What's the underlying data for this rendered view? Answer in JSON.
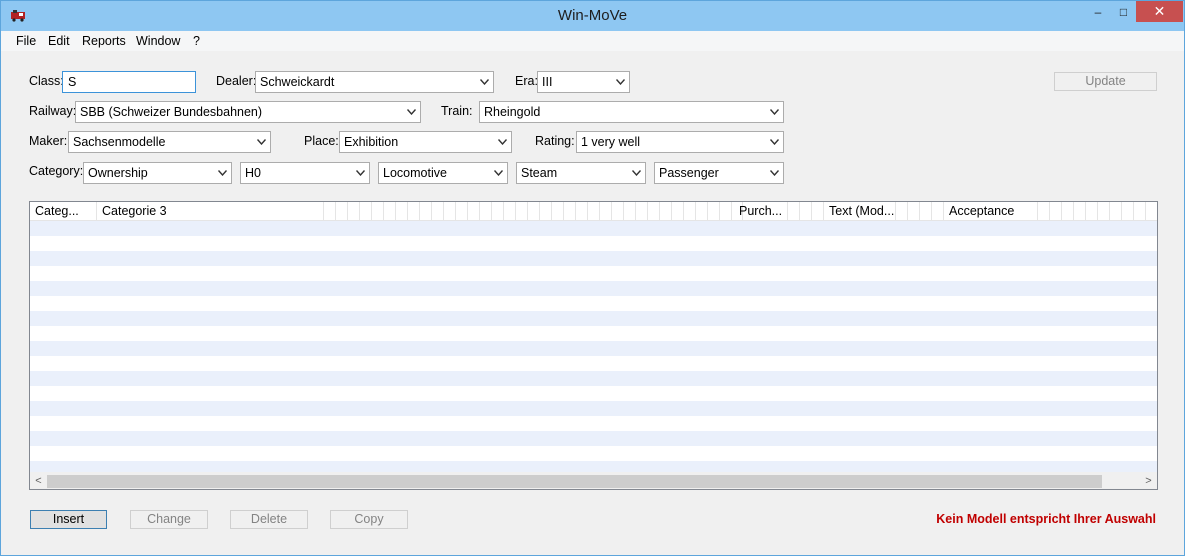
{
  "window": {
    "title": "Win-MoVe",
    "minimize": "–",
    "maximize": "□",
    "close": "✕"
  },
  "menu": {
    "items": [
      "File",
      "Edit",
      "Reports",
      "Window",
      "?"
    ]
  },
  "filters": {
    "class": {
      "label": "Class:",
      "value": "S"
    },
    "dealer": {
      "label": "Dealer:",
      "value": "Schweickardt"
    },
    "era": {
      "label": "Era:",
      "value": "III"
    },
    "railway": {
      "label": "Railway:",
      "value": "SBB (Schweizer Bundesbahnen)"
    },
    "train": {
      "label": "Train:",
      "value": "Rheingold"
    },
    "maker": {
      "label": "Maker:",
      "value": "Sachsenmodelle"
    },
    "place": {
      "label": "Place:",
      "value": "Exhibition"
    },
    "rating": {
      "label": "Rating:",
      "value": "1 very well"
    },
    "category": {
      "label": "Category:",
      "values": [
        "Ownership",
        "H0",
        "Locomotive",
        "Steam",
        "Passenger"
      ]
    }
  },
  "update_button": "Update",
  "table": {
    "columns": [
      "Categ...",
      "Categorie 3",
      "Purch...",
      "Text (Mod...",
      "Acceptance"
    ]
  },
  "actions": {
    "insert": "Insert",
    "change": "Change",
    "delete": "Delete",
    "copy": "Copy"
  },
  "status": {
    "message": "Kein Modell entspricht Ihrer Auswahl",
    "color": "#c00000"
  }
}
